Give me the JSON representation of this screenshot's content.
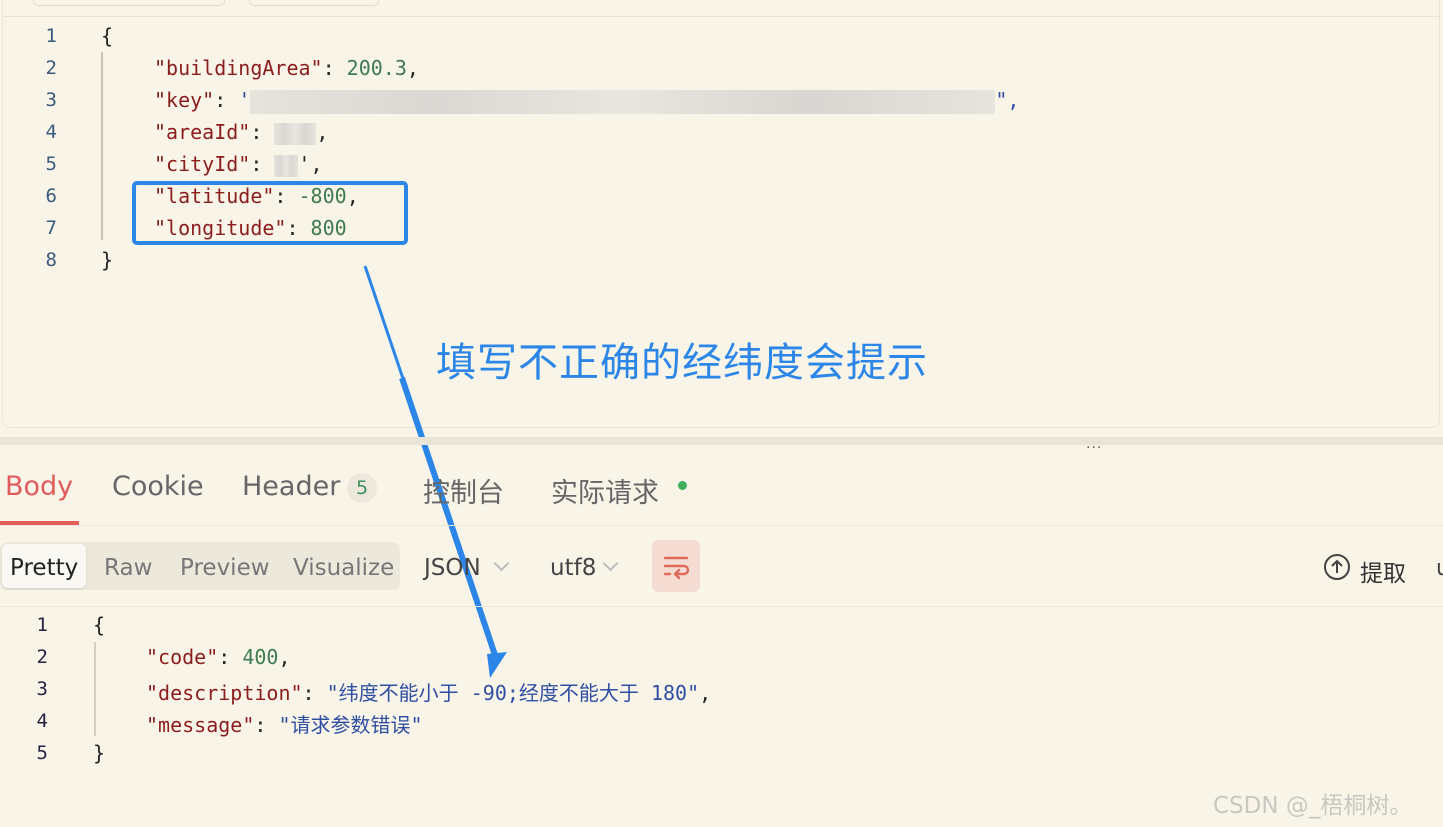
{
  "request_body": {
    "lines": [
      {
        "num": "1",
        "text": "{"
      },
      {
        "num": "2",
        "key": "\"buildingArea\"",
        "colon": ": ",
        "value": "200.3",
        "tail": ","
      },
      {
        "num": "3",
        "key": "\"key\"",
        "colon": ": ",
        "value": "'",
        "tail": "\","
      },
      {
        "num": "4",
        "key": "\"areaId\"",
        "colon": ": ",
        "tail": ","
      },
      {
        "num": "5",
        "key": "\"cityId\"",
        "colon": ": ",
        "tail": "',"
      },
      {
        "num": "6",
        "key": "\"latitude\"",
        "colon": ": ",
        "value": "-800",
        "tail": ","
      },
      {
        "num": "7",
        "key": "\"longitude\"",
        "colon": ": ",
        "value": "800"
      },
      {
        "num": "8",
        "text": "}"
      }
    ]
  },
  "annotation": {
    "text": "填写不正确的经纬度会提示",
    "color": "#2b86e8"
  },
  "splitter": {
    "handle": "..."
  },
  "response_tabs": {
    "body": "Body",
    "cookie": "Cookie",
    "header": "Header",
    "header_count": "5",
    "console": "控制台",
    "actual_request": "实际请求",
    "active": "Body",
    "active_color": "#e05b5b"
  },
  "toolbar": {
    "views": [
      "Pretty",
      "Raw",
      "Preview",
      "Visualize"
    ],
    "active_view": "Pretty",
    "format": "JSON",
    "encoding": "utf8",
    "wrap_icon": "wrap-lines-icon",
    "extract_icon": "arrow-up-circle-icon",
    "extract": "提取",
    "edge_char": "u"
  },
  "response_body": {
    "lines": [
      {
        "num": "1",
        "text": "{"
      },
      {
        "num": "2",
        "key": "\"code\"",
        "colon": ": ",
        "value": "400",
        "tail": ","
      },
      {
        "num": "3",
        "key": "\"description\"",
        "colon": ": ",
        "str_a": "\"纬度不能小于 ",
        "str_b": "-90;",
        "str_c": "经度不能大于 ",
        "str_d": "180\"",
        "tail": ","
      },
      {
        "num": "4",
        "key": "\"message\"",
        "colon": ": ",
        "str_a": "\"请求参数错误\""
      },
      {
        "num": "5",
        "text": "}"
      }
    ]
  },
  "watermark": "CSDN @_梧桐树。"
}
